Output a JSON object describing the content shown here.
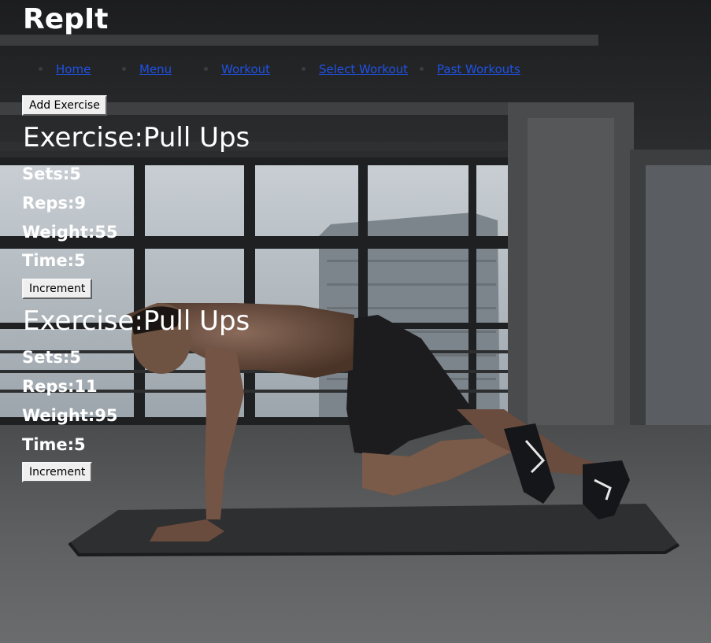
{
  "app": {
    "title": "RepIt"
  },
  "nav": {
    "items": [
      {
        "label": "Home"
      },
      {
        "label": "Menu"
      },
      {
        "label": "Workout"
      },
      {
        "label": "Select Workout"
      },
      {
        "label": "Past Workouts"
      }
    ]
  },
  "toolbar": {
    "add_exercise_label": "Add Exercise"
  },
  "exercises": [
    {
      "title": "Exercise:Pull Ups",
      "sets": "Sets:5",
      "reps": "Reps:9",
      "weight": "Weight:55",
      "time": "Time:5",
      "increment_label": "Increment"
    },
    {
      "title": "Exercise:Pull Ups",
      "sets": "Sets:5",
      "reps": "Reps:11",
      "weight": "Weight:95",
      "time": "Time:5",
      "increment_label": "Increment"
    }
  ],
  "colors": {
    "link": "#1f52e6",
    "heading": "#ffffff",
    "button_bg": "#efefef"
  },
  "background": {
    "icon": "gym-athlete-plank-photo"
  }
}
